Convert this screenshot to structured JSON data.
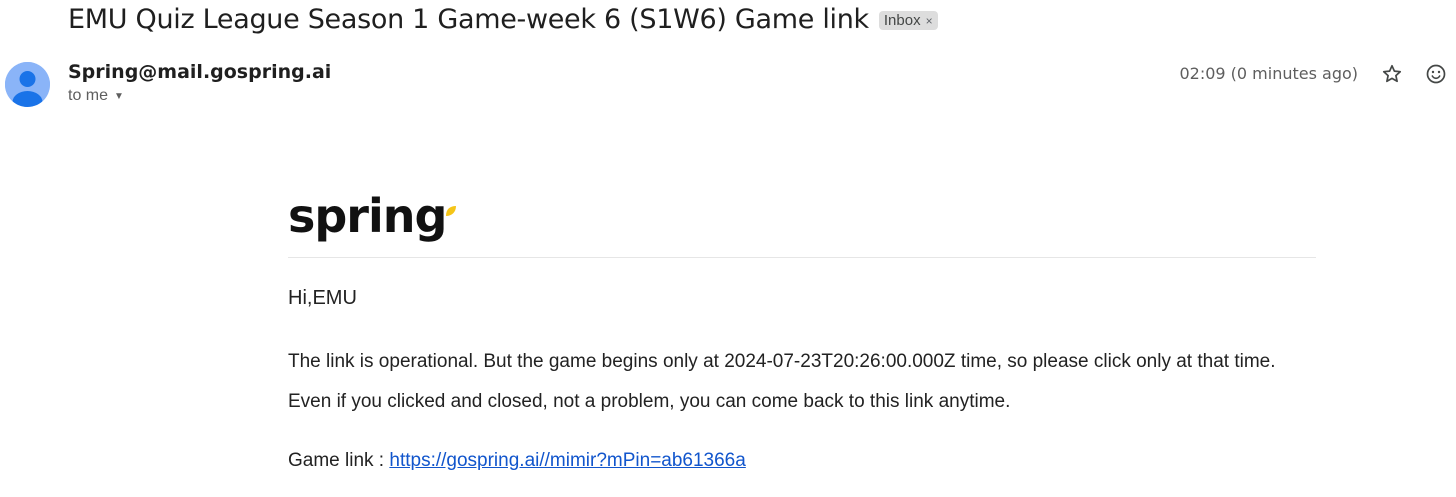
{
  "email": {
    "subject": "EMU Quiz League Season 1 Game-week 6 (S1W6) Game link",
    "label": "Inbox",
    "label_remove": "×",
    "sender": "Spring@mail.gospring.ai",
    "recipient": "to me",
    "timestamp": "02:09 (0 minutes ago)"
  },
  "icons": {
    "avatar": "person-icon",
    "star": "star-icon",
    "emoji": "emoji-reaction-icon",
    "recipient_caret": "chevron-down-icon"
  },
  "body": {
    "logo_text": "spring",
    "greeting": "Hi,EMU",
    "line1": "The link is operational. But the game begins only at 2024-07-23T20:26:00.000Z time, so please click only at that time.",
    "line2": "Even if you clicked and closed, not a problem, you can come back to this link anytime.",
    "game_link_label": "Game link : ",
    "game_link_url": "https://gospring.ai//mimir?mPin=ab61366a"
  },
  "colors": {
    "link": "#1155cc",
    "avatar_bg": "#8ab4f8",
    "avatar_fg": "#1a73e8",
    "logo_leaf": "#f5c518"
  }
}
